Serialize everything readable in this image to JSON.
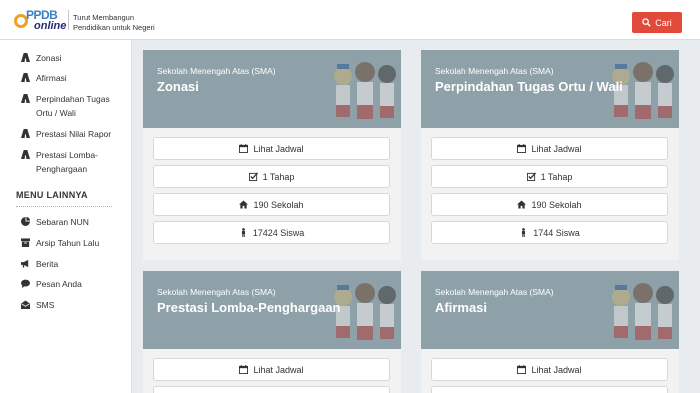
{
  "header": {
    "logo": {
      "ppdb": "PPDB",
      "online": "online"
    },
    "tagline_line1": "Turut Membangun",
    "tagline_line2": "Pendidikan untuk Negeri",
    "search_label": "Cari"
  },
  "sidebar": {
    "items": [
      {
        "label": "Zonasi",
        "icon": "road-icon"
      },
      {
        "label": "Afirmasi",
        "icon": "road-icon"
      },
      {
        "label": "Perpindahan Tugas Ortu / Wali",
        "icon": "road-icon"
      },
      {
        "label": "Prestasi Nilai Rapor",
        "icon": "road-icon"
      },
      {
        "label": "Prestasi Lomba-Penghargaan",
        "icon": "road-icon"
      }
    ],
    "other_heading": "MENU LAINNYA",
    "other_items": [
      {
        "label": "Sebaran NUN",
        "icon": "pie-chart-icon"
      },
      {
        "label": "Arsip Tahun Lalu",
        "icon": "archive-icon"
      },
      {
        "label": "Berita",
        "icon": "megaphone-icon"
      },
      {
        "label": "Pesan Anda",
        "icon": "chat-icon"
      },
      {
        "label": "SMS",
        "icon": "envelope-icon"
      }
    ]
  },
  "cards": [
    {
      "subtitle": "Sekolah Menengah Atas (SMA)",
      "title": "Zonasi",
      "jadwal": "Lihat Jadwal",
      "tahap": "1 Tahap",
      "sekolah": "190 Sekolah",
      "siswa": "17424 Siswa"
    },
    {
      "subtitle": "Sekolah Menengah Atas (SMA)",
      "title": "Perpindahan Tugas Ortu / Wali",
      "jadwal": "Lihat Jadwal",
      "tahap": "1 Tahap",
      "sekolah": "190 Sekolah",
      "siswa": "1744 Siswa"
    },
    {
      "subtitle": "Sekolah Menengah Atas (SMA)",
      "title": "Prestasi Lomba-Penghargaan",
      "jadwal": "Lihat Jadwal"
    },
    {
      "subtitle": "Sekolah Menengah Atas (SMA)",
      "title": "Afirmasi",
      "jadwal": "Lihat Jadwal"
    }
  ],
  "colors": {
    "accent": "#e14a3b",
    "card_header": "#8fa1a8",
    "brand_blue": "#3a7fc1"
  }
}
